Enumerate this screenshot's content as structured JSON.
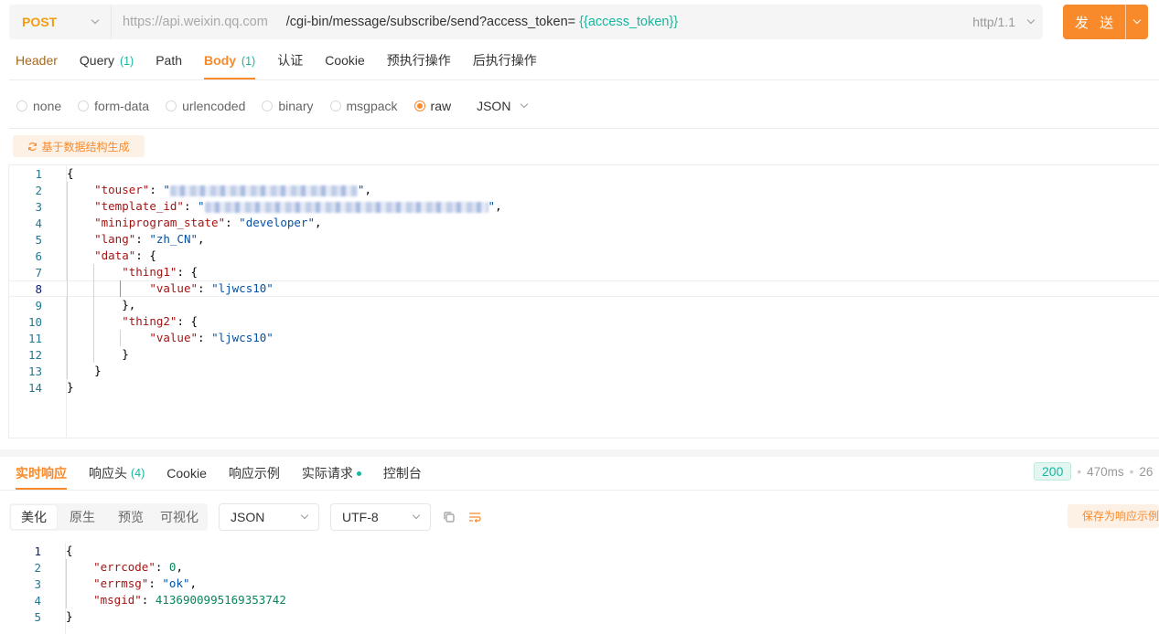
{
  "request": {
    "method": "POST",
    "url_host": "https://api.weixin.qq.com",
    "url_path": "/cgi-bin/message/subscribe/send?access_token=",
    "url_variable": "{{access_token}}",
    "http_version": "http/1.1",
    "send_label": "发 送"
  },
  "request_tabs": [
    {
      "label": "Header",
      "count": ""
    },
    {
      "label": "Query",
      "count": "(1)"
    },
    {
      "label": "Path",
      "count": ""
    },
    {
      "label": "Body",
      "count": "(1)"
    },
    {
      "label": "认证",
      "count": ""
    },
    {
      "label": "Cookie",
      "count": ""
    },
    {
      "label": "预执行操作",
      "count": ""
    },
    {
      "label": "后执行操作",
      "count": ""
    }
  ],
  "body_types": [
    "none",
    "form-data",
    "urlencoded",
    "binary",
    "msgpack",
    "raw"
  ],
  "body_type_selected": "raw",
  "body_format": "JSON",
  "generate_button": "基于数据结构生成",
  "request_body": {
    "line_numbers": [
      "1",
      "2",
      "3",
      "4",
      "5",
      "6",
      "7",
      "8",
      "9",
      "10",
      "11",
      "12",
      "13",
      "14"
    ],
    "miniprogram_state": "developer",
    "lang": "zh_CN",
    "thing1_value": "ljwcs10",
    "thing2_value": "ljwcs10"
  },
  "response_tabs": [
    {
      "label": "实时响应",
      "count": ""
    },
    {
      "label": "响应头",
      "count": "(4)"
    },
    {
      "label": "Cookie",
      "count": ""
    },
    {
      "label": "响应示例",
      "count": ""
    },
    {
      "label": "实际请求",
      "count": ""
    },
    {
      "label": "控制台",
      "count": ""
    }
  ],
  "response_status": {
    "code": "200",
    "time": "470ms",
    "size": "26"
  },
  "view_modes": [
    "美化",
    "原生",
    "预览",
    "可视化"
  ],
  "response_format": "JSON",
  "response_encoding": "UTF-8",
  "save_example_button": "保存为响应示例",
  "response_body": {
    "line_numbers": [
      "1",
      "2",
      "3",
      "4",
      "5"
    ],
    "errcode": "0",
    "errmsg": "ok",
    "msgid": "4136900995169353742"
  },
  "colors": {
    "accent": "#f98a2b",
    "teal": "#15b79e",
    "json_key": "#a31515",
    "json_string": "#0451a5",
    "json_number": "#098658"
  }
}
